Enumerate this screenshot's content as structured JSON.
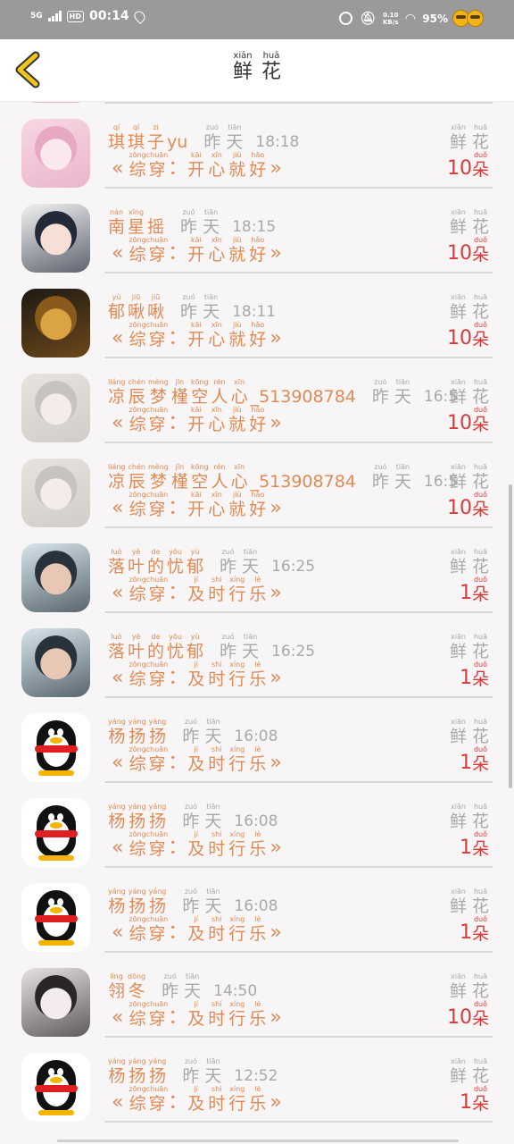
{
  "status_bar": {
    "network": "5G",
    "hd": "HD",
    "time": "00:14",
    "speed_value": "0.10",
    "speed_unit": "KB/s",
    "battery": "95%"
  },
  "header": {
    "title_chars": [
      {
        "py": "xiān",
        "hz": "鲜"
      },
      {
        "py": "huā",
        "hz": "花"
      }
    ]
  },
  "labels": {
    "day_chars": [
      {
        "py": "zuó",
        "hz": "昨"
      },
      {
        "py": "tiān",
        "hz": "天"
      }
    ],
    "flower_chars": [
      {
        "py": "xiān",
        "hz": "鲜"
      },
      {
        "py": "huā",
        "hz": "花"
      }
    ],
    "unit_char": {
      "py": "duǒ",
      "hz": "朵"
    },
    "book_prefix": [
      {
        "py": "zōng",
        "hz": "综"
      },
      {
        "py": "chuān",
        "hz": "穿"
      }
    ],
    "colon": "：",
    "quote_open": "«",
    "quote_close": "»"
  },
  "books": {
    "happy": [
      {
        "py": "kāi",
        "hz": "开"
      },
      {
        "py": "xīn",
        "hz": "心"
      },
      {
        "py": "jiù",
        "hz": "就"
      },
      {
        "py": "hǎo",
        "hz": "好"
      }
    ],
    "timely": [
      {
        "py": "jí",
        "hz": "及"
      },
      {
        "py": "shí",
        "hz": "时"
      },
      {
        "py": "xíng",
        "hz": "行"
      },
      {
        "py": "lè",
        "hz": "乐"
      }
    ]
  },
  "rows": [
    {
      "name": [],
      "latin": "",
      "time": "",
      "book": "happy",
      "count": "10",
      "avatar": "pink",
      "partial": true
    },
    {
      "name": [
        {
          "py": "qí",
          "hz": "琪"
        },
        {
          "py": "qí",
          "hz": "琪"
        },
        {
          "py": "zi",
          "hz": "子"
        }
      ],
      "latin": "yu",
      "time": "18:18",
      "book": "happy",
      "count": "10",
      "avatar": "pink"
    },
    {
      "name": [
        {
          "py": "nán",
          "hz": "南"
        },
        {
          "py": "xīng",
          "hz": "星"
        },
        {
          "py": "",
          "hz": "摇"
        }
      ],
      "latin": "",
      "time": "18:15",
      "book": "happy",
      "count": "10",
      "avatar": "boy"
    },
    {
      "name": [
        {
          "py": "yù",
          "hz": "郁"
        },
        {
          "py": "jiū",
          "hz": "啾"
        },
        {
          "py": "jiū",
          "hz": "啾"
        }
      ],
      "latin": "",
      "time": "18:11",
      "book": "happy",
      "count": "10",
      "avatar": "pika"
    },
    {
      "name": [
        {
          "py": "liáng",
          "hz": "凉"
        },
        {
          "py": "chén",
          "hz": "辰"
        },
        {
          "py": "mèng",
          "hz": "梦"
        },
        {
          "py": "jǐn",
          "hz": "槿"
        },
        {
          "py": "kōng",
          "hz": "空"
        },
        {
          "py": "rén",
          "hz": "人"
        },
        {
          "py": "xīn",
          "hz": "心"
        }
      ],
      "latin": "_513908784",
      "time": "16:5",
      "book": "happy",
      "count": "10",
      "avatar": "white"
    },
    {
      "name": [
        {
          "py": "liáng",
          "hz": "凉"
        },
        {
          "py": "chén",
          "hz": "辰"
        },
        {
          "py": "mèng",
          "hz": "梦"
        },
        {
          "py": "jǐn",
          "hz": "槿"
        },
        {
          "py": "kōng",
          "hz": "空"
        },
        {
          "py": "rén",
          "hz": "人"
        },
        {
          "py": "xīn",
          "hz": "心"
        }
      ],
      "latin": "_513908784",
      "time": "16:5",
      "book": "happy",
      "count": "10",
      "avatar": "white"
    },
    {
      "name": [
        {
          "py": "luò",
          "hz": "落"
        },
        {
          "py": "yè",
          "hz": "叶"
        },
        {
          "py": "de",
          "hz": "的"
        },
        {
          "py": "yōu",
          "hz": "忧"
        },
        {
          "py": "yù",
          "hz": "郁"
        }
      ],
      "latin": "",
      "time": "16:25",
      "book": "timely",
      "count": "1",
      "avatar": "woman"
    },
    {
      "name": [
        {
          "py": "luò",
          "hz": "落"
        },
        {
          "py": "yè",
          "hz": "叶"
        },
        {
          "py": "de",
          "hz": "的"
        },
        {
          "py": "yōu",
          "hz": "忧"
        },
        {
          "py": "yù",
          "hz": "郁"
        }
      ],
      "latin": "",
      "time": "16:25",
      "book": "timely",
      "count": "1",
      "avatar": "woman"
    },
    {
      "name": [
        {
          "py": "yáng",
          "hz": "杨"
        },
        {
          "py": "yáng",
          "hz": "扬"
        },
        {
          "py": "yáng",
          "hz": "扬"
        }
      ],
      "latin": "",
      "time": "16:08",
      "book": "timely",
      "count": "1",
      "avatar": "penguin"
    },
    {
      "name": [
        {
          "py": "yáng",
          "hz": "杨"
        },
        {
          "py": "yáng",
          "hz": "扬"
        },
        {
          "py": "yáng",
          "hz": "扬"
        }
      ],
      "latin": "",
      "time": "16:08",
      "book": "timely",
      "count": "1",
      "avatar": "penguin"
    },
    {
      "name": [
        {
          "py": "yáng",
          "hz": "杨"
        },
        {
          "py": "yáng",
          "hz": "扬"
        },
        {
          "py": "yáng",
          "hz": "扬"
        }
      ],
      "latin": "",
      "time": "16:08",
      "book": "timely",
      "count": "1",
      "avatar": "penguin"
    },
    {
      "name": [
        {
          "py": "líng",
          "hz": "翎"
        },
        {
          "py": "dōng",
          "hz": "冬"
        }
      ],
      "latin": "",
      "time": "14:50",
      "book": "timely",
      "count": "10",
      "avatar": "drawn"
    },
    {
      "name": [
        {
          "py": "yáng",
          "hz": "杨"
        },
        {
          "py": "yáng",
          "hz": "扬"
        },
        {
          "py": "yáng",
          "hz": "扬"
        }
      ],
      "latin": "",
      "time": "12:52",
      "book": "timely",
      "count": "1",
      "avatar": "penguin"
    }
  ],
  "colors": {
    "accent_orange": "#e08a55",
    "count_red": "#d83a3a",
    "muted_gray": "#a9a9a9",
    "status_bar": "#9a9a9a",
    "back_arrow": "#f0c419"
  },
  "avatar_palettes": {
    "pink": {
      "bg": "#f6d7e2",
      "face": "#fbe8ec",
      "hair": "#e7a8c4"
    },
    "boy": {
      "bg": "#f2f2f2",
      "face": "#f6e0d6",
      "hair": "#222a3a"
    },
    "pika": {
      "bg": "#1d1a14",
      "face": "#d9a441",
      "hair": "#8a5a1c"
    },
    "white": {
      "bg": "#e9e3e0",
      "face": "#f3ece8",
      "hair": "#c9c3c0"
    },
    "woman": {
      "bg": "#d7e6ec",
      "face": "#e8c8b4",
      "hair": "#27323a"
    },
    "drawn": {
      "bg": "#e6e1e2",
      "face": "#f4ecec",
      "hair": "#2a2628"
    }
  }
}
